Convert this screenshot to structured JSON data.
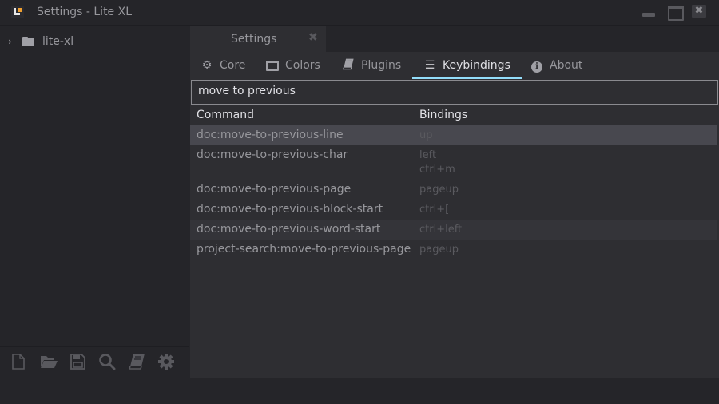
{
  "window": {
    "title": "Settings - Lite XL",
    "controls": [
      "minimize",
      "maximize",
      "close"
    ]
  },
  "sidebar": {
    "tree": [
      {
        "label": "lite-xl",
        "icon": "folder-icon",
        "expanded": false
      }
    ],
    "toolbar": [
      {
        "name": "new-file",
        "icon": "file-icon"
      },
      {
        "name": "open-folder",
        "icon": "folder-open-icon"
      },
      {
        "name": "save",
        "icon": "save-icon"
      },
      {
        "name": "find",
        "icon": "search-icon"
      },
      {
        "name": "commands",
        "icon": "book-icon"
      },
      {
        "name": "settings",
        "icon": "gear-icon"
      }
    ]
  },
  "tabs": [
    {
      "label": "Settings",
      "close": "✖"
    }
  ],
  "settings_nav": [
    {
      "label": "Core",
      "icon": "gear-icon",
      "glyph": "⚙"
    },
    {
      "label": "Colors",
      "icon": "window-icon",
      "glyph": "▭"
    },
    {
      "label": "Plugins",
      "icon": "book-icon",
      "glyph": "📘"
    },
    {
      "label": "Keybindings",
      "icon": "menu-icon",
      "glyph": "☰",
      "active": true
    },
    {
      "label": "About",
      "icon": "info-icon",
      "glyph": "ℹ"
    }
  ],
  "search": {
    "value": "move to previous"
  },
  "table": {
    "headers": {
      "command": "Command",
      "bindings": "Bindings"
    },
    "rows": [
      {
        "command": "doc:move-to-previous-line",
        "bindings": [
          "up"
        ]
      },
      {
        "command": "doc:move-to-previous-char",
        "bindings": [
          "left",
          "ctrl+m"
        ]
      },
      {
        "command": "doc:move-to-previous-page",
        "bindings": [
          "pageup"
        ]
      },
      {
        "command": "doc:move-to-previous-block-start",
        "bindings": [
          "ctrl+["
        ]
      },
      {
        "command": "doc:move-to-previous-word-start",
        "bindings": [
          "ctrl+left"
        ]
      },
      {
        "command": "project-search:move-to-previous-page",
        "bindings": [
          "pageup"
        ]
      }
    ]
  },
  "colors": {
    "accent": "#93ddfa",
    "background": "#2e2e32",
    "sidebar_bg": "#252529",
    "text": "#97979c",
    "text_bright": "#e1e1e6",
    "selected_row": "#48484f",
    "hover_row": "#343439"
  }
}
